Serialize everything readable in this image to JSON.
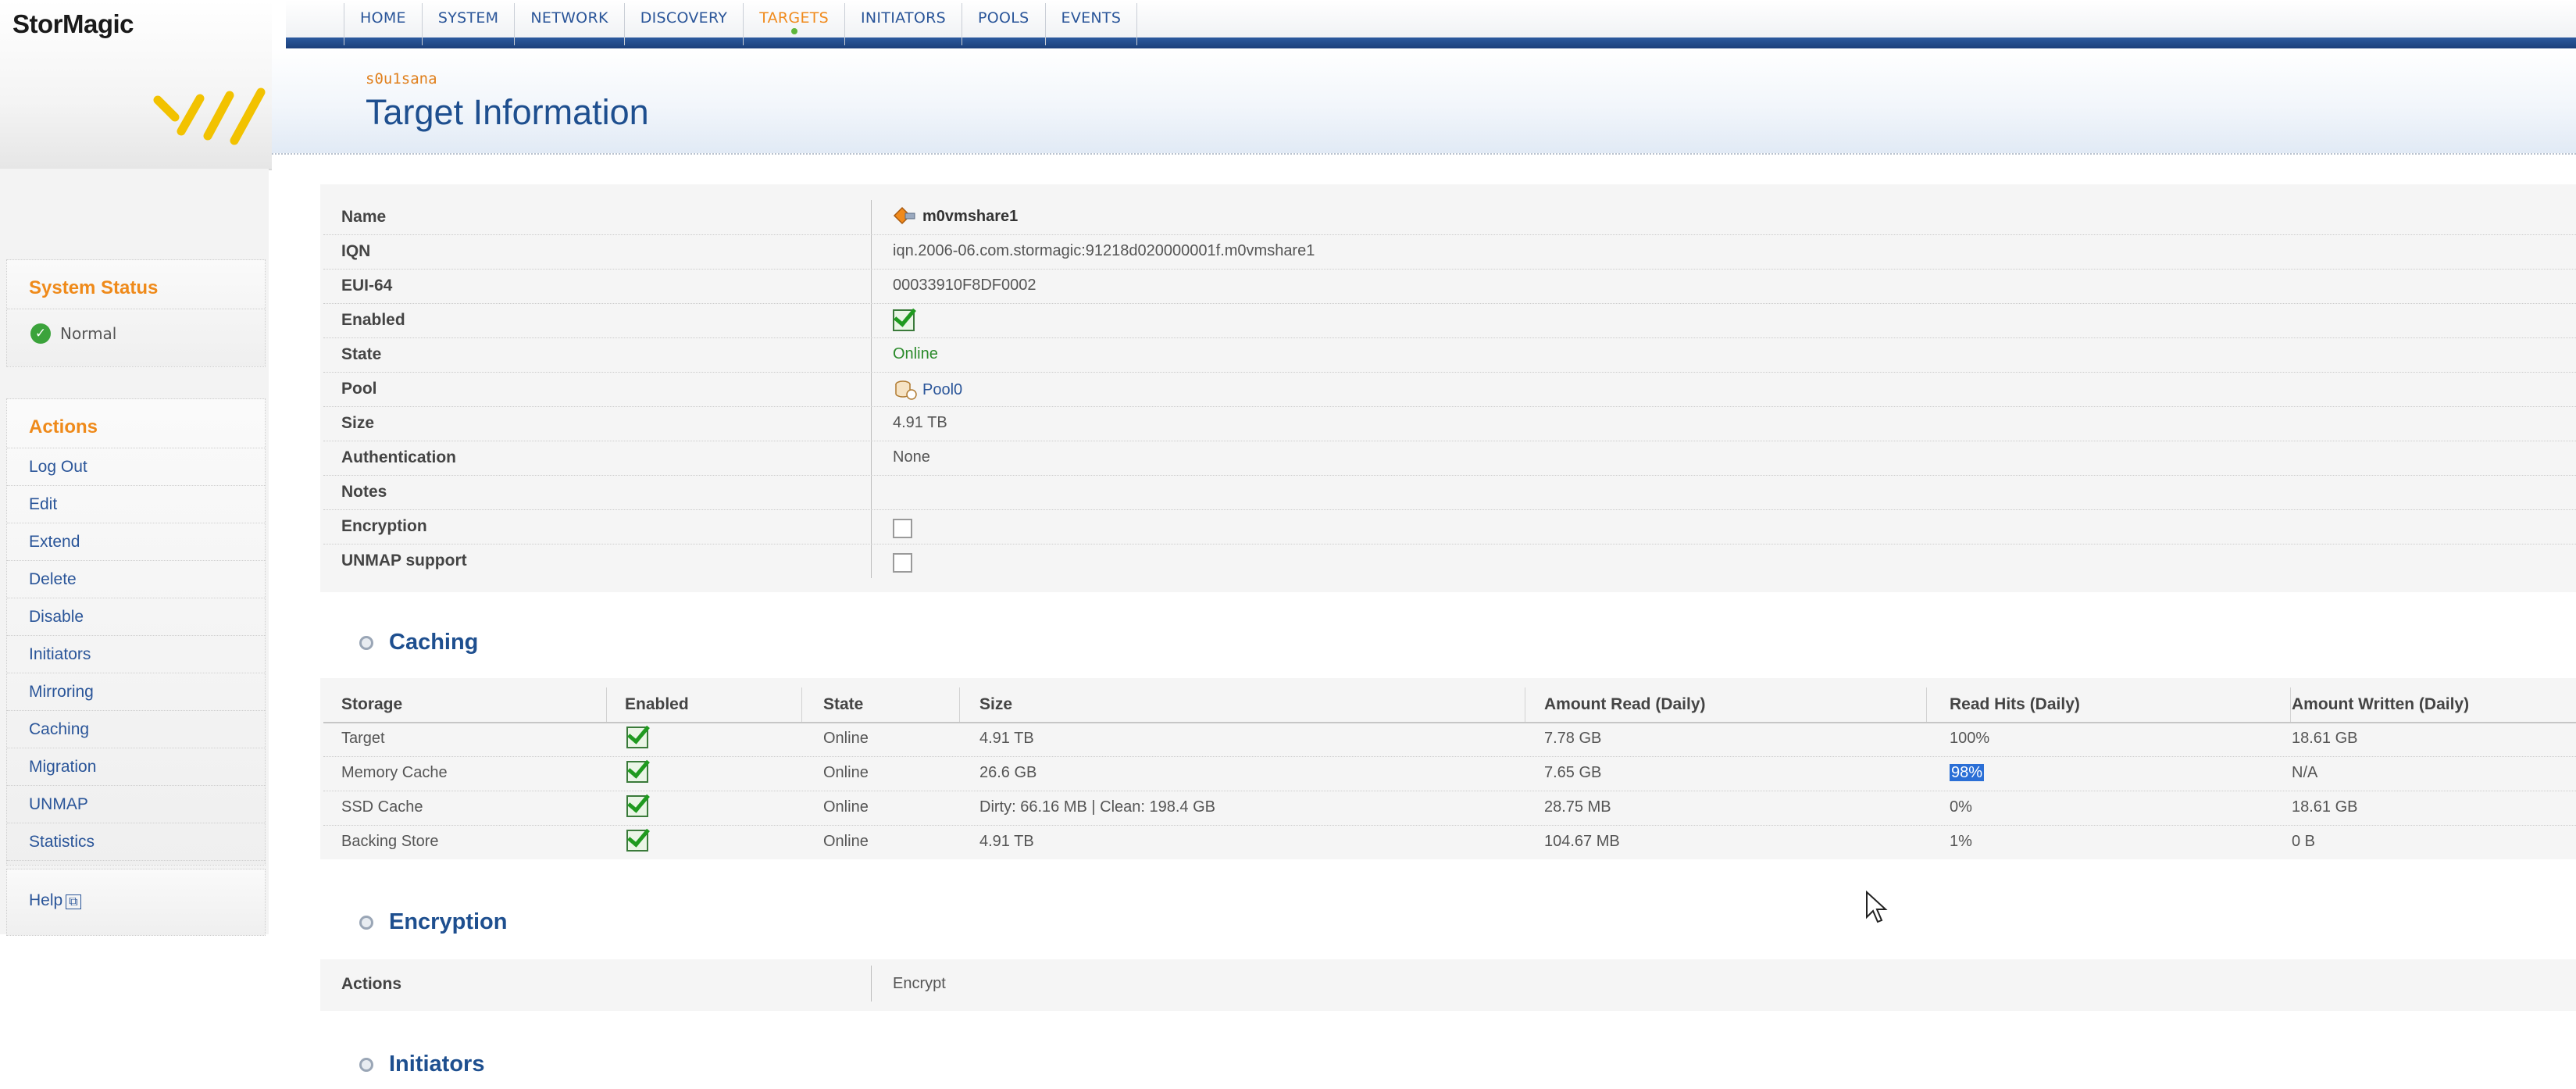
{
  "brand": {
    "name": "StorMagic"
  },
  "nav": {
    "tabs": [
      "HOME",
      "SYSTEM",
      "NETWORK",
      "DISCOVERY",
      "TARGETS",
      "INITIATORS",
      "POOLS",
      "EVENTS"
    ],
    "active": "TARGETS"
  },
  "header": {
    "host": "s0u1sana",
    "title": "Target Information"
  },
  "sidebar": {
    "status_heading": "System Status",
    "status_value": "Normal",
    "actions_heading": "Actions",
    "actions": [
      "Log Out",
      "Edit",
      "Extend",
      "Delete",
      "Disable",
      "Initiators",
      "Mirroring",
      "Caching",
      "Migration",
      "UNMAP",
      "Statistics"
    ],
    "help": "Help"
  },
  "info": {
    "rows": [
      {
        "label": "Name",
        "value": "m0vmshare1"
      },
      {
        "label": "IQN",
        "value": "iqn.2006-06.com.stormagic:91218d020000001f.m0vmshare1"
      },
      {
        "label": "EUI-64",
        "value": "00033910F8DF0002"
      },
      {
        "label": "Enabled",
        "value": true
      },
      {
        "label": "State",
        "value": "Online"
      },
      {
        "label": "Pool",
        "value": "Pool0"
      },
      {
        "label": "Size",
        "value": "4.91 TB"
      },
      {
        "label": "Authentication",
        "value": "None"
      },
      {
        "label": "Notes",
        "value": ""
      },
      {
        "label": "Encryption",
        "value": false
      },
      {
        "label": "UNMAP support",
        "value": false
      }
    ]
  },
  "caching": {
    "heading": "Caching",
    "columns": [
      "Storage",
      "Enabled",
      "State",
      "Size",
      "Amount Read (Daily)",
      "Read Hits (Daily)",
      "Amount Written (Daily)"
    ],
    "rows": [
      {
        "storage": "Target",
        "enabled": true,
        "state": "Online",
        "size": "4.91 TB",
        "read": "7.78 GB",
        "hits": "100%",
        "written": "18.61 GB"
      },
      {
        "storage": "Memory Cache",
        "enabled": true,
        "state": "Online",
        "size": "26.6 GB",
        "read": "7.65 GB",
        "hits": "98%",
        "written": "N/A"
      },
      {
        "storage": "SSD Cache",
        "enabled": true,
        "state": "Online",
        "size": "Dirty: 66.16 MB | Clean: 198.4 GB",
        "read": "28.75 MB",
        "hits": "0%",
        "written": "18.61 GB"
      },
      {
        "storage": "Backing Store",
        "enabled": true,
        "state": "Online",
        "size": "4.91 TB",
        "read": "104.67 MB",
        "hits": "1%",
        "written": "0 B"
      }
    ]
  },
  "encryption": {
    "heading": "Encryption",
    "label": "Actions",
    "value": "Encrypt"
  },
  "initiators": {
    "heading": "Initiators"
  },
  "colors": {
    "accent": "#ef8a1a",
    "link": "#2a5599",
    "title": "#1e4f8f",
    "online": "#2a8a2a"
  },
  "icons": {
    "status": "check-circle-icon",
    "name": "target-icon",
    "pool": "pool-icon",
    "help": "external-link-icon"
  }
}
